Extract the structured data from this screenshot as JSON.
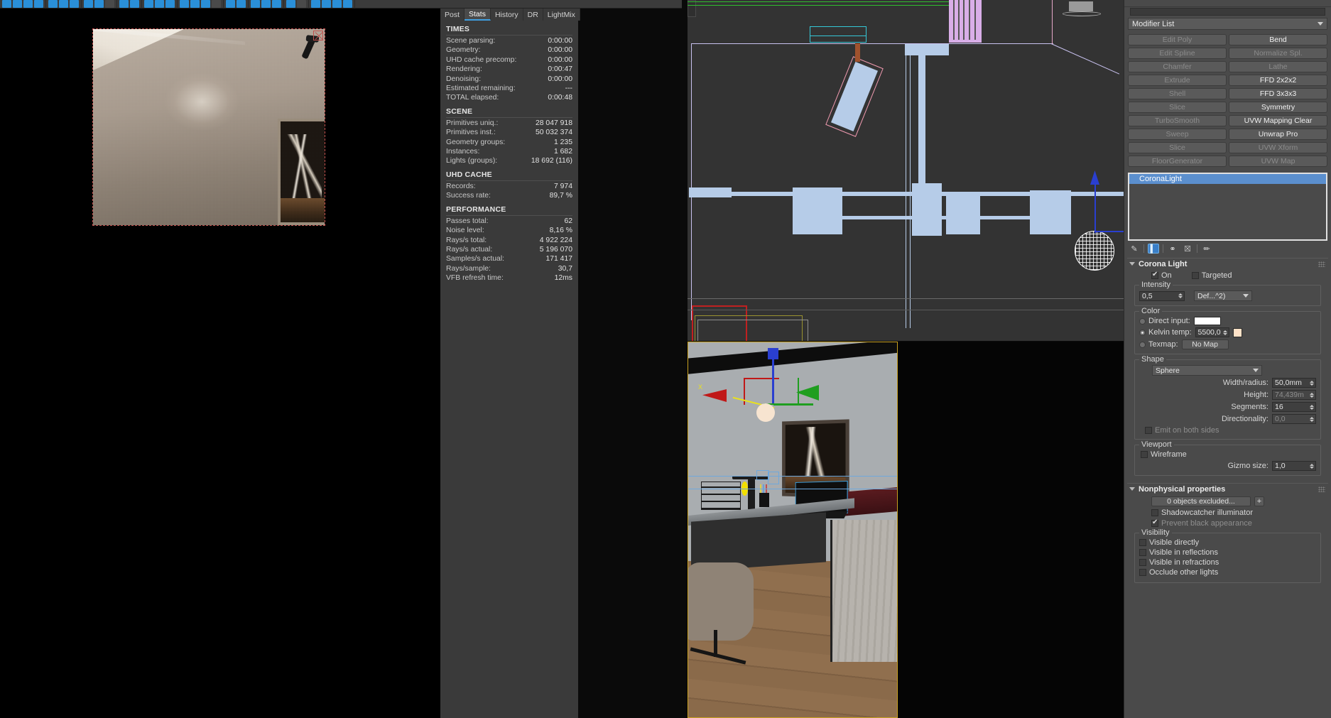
{
  "toolbar": {
    "icon_groups": [
      4,
      3,
      3,
      2,
      3,
      4,
      2,
      3,
      2,
      4
    ]
  },
  "vfb": {
    "tabs": [
      {
        "label": "Post",
        "active": false
      },
      {
        "label": "Stats",
        "active": true
      },
      {
        "label": "History",
        "active": false
      },
      {
        "label": "DR",
        "active": false
      },
      {
        "label": "LightMix",
        "active": false
      }
    ],
    "sections": [
      {
        "title": "TIMES",
        "rows": [
          {
            "key": "Scene parsing:",
            "value": "0:00:00"
          },
          {
            "key": "Geometry:",
            "value": "0:00:00"
          },
          {
            "key": "UHD cache precomp:",
            "value": "0:00:00"
          },
          {
            "key": "Rendering:",
            "value": "0:00:47"
          },
          {
            "key": "Denoising:",
            "value": "0:00:00"
          },
          {
            "key": "Estimated remaining:",
            "value": "---"
          },
          {
            "key": "TOTAL elapsed:",
            "value": "0:00:48"
          }
        ]
      },
      {
        "title": "SCENE",
        "rows": [
          {
            "key": "Primitives uniq.:",
            "value": "28 047 918"
          },
          {
            "key": "Primitives inst.:",
            "value": "50 032 374"
          },
          {
            "key": "Geometry groups:",
            "value": "1 235"
          },
          {
            "key": "Instances:",
            "value": "1 682"
          },
          {
            "key": "Lights (groups):",
            "value": "18 692 (116)"
          }
        ]
      },
      {
        "title": "UHD CACHE",
        "rows": [
          {
            "key": "Records:",
            "value": "7 974"
          },
          {
            "key": "Success rate:",
            "value": "89,7 %"
          }
        ]
      },
      {
        "title": "PERFORMANCE",
        "rows": [
          {
            "key": "Passes total:",
            "value": "62"
          },
          {
            "key": "Noise level:",
            "value": "8,16 %"
          },
          {
            "key": "Rays/s total:",
            "value": "4 922 224"
          },
          {
            "key": "Rays/s actual:",
            "value": "5 196 070"
          },
          {
            "key": "Samples/s actual:",
            "value": "171 417"
          },
          {
            "key": "Rays/sample:",
            "value": "30,7"
          },
          {
            "key": "VFB refresh time:",
            "value": "12ms"
          }
        ]
      }
    ]
  },
  "command_panel": {
    "modifier_list_label": "Modifier List",
    "modifier_buttons": [
      {
        "label": "Edit Poly",
        "enabled": false
      },
      {
        "label": "Bend",
        "enabled": true
      },
      {
        "label": "Edit Spline",
        "enabled": false
      },
      {
        "label": "Normalize Spl.",
        "enabled": false
      },
      {
        "label": "Chamfer",
        "enabled": false
      },
      {
        "label": "Lathe",
        "enabled": false
      },
      {
        "label": "Extrude",
        "enabled": false
      },
      {
        "label": "FFD 2x2x2",
        "enabled": true
      },
      {
        "label": "Shell",
        "enabled": false
      },
      {
        "label": "FFD 3x3x3",
        "enabled": true
      },
      {
        "label": "Slice",
        "enabled": false
      },
      {
        "label": "Symmetry",
        "enabled": true
      },
      {
        "label": "TurboSmooth",
        "enabled": false
      },
      {
        "label": "UVW Mapping Clear",
        "enabled": true
      },
      {
        "label": "Sweep",
        "enabled": false
      },
      {
        "label": "Unwrap Pro",
        "enabled": true
      },
      {
        "label": "Slice",
        "enabled": false
      },
      {
        "label": "UVW Xform",
        "enabled": false
      },
      {
        "label": "FloorGenerator",
        "enabled": false
      },
      {
        "label": "UVW Map",
        "enabled": false
      }
    ],
    "modifier_stack": [
      {
        "label": "CoronaLight",
        "selected": true
      }
    ],
    "stack_tools": [
      {
        "name": "pin-stack-icon",
        "glyph": "✒",
        "active": false
      },
      {
        "name": "show-end-result-icon",
        "glyph": "▐",
        "active": true
      },
      {
        "name": "make-unique-icon",
        "glyph": "⚭",
        "active": false
      },
      {
        "name": "remove-modifier-icon",
        "glyph": "Ὕ1",
        "active": false
      },
      {
        "name": "configure-sets-icon",
        "glyph": "✎",
        "active": false
      }
    ],
    "corona_light": {
      "title": "Corona Light",
      "on_label": "On",
      "on_checked": true,
      "targeted_label": "Targeted",
      "targeted_checked": false,
      "intensity_group": "Intensity",
      "intensity_value": "0,5",
      "intensity_units": "Def...^2)",
      "color_group": "Color",
      "direct_input_label": "Direct input:",
      "direct_input_selected": false,
      "direct_input_color": "#ffffff",
      "kelvin_label": "Kelvin temp:",
      "kelvin_selected": true,
      "kelvin_value": "5500,0",
      "kelvin_color": "#ffe2c8",
      "texmap_label": "Texmap:",
      "texmap_selected": false,
      "texmap_value": "No Map",
      "shape_group": "Shape",
      "shape_value": "Sphere",
      "width_radius_label": "Width/radius:",
      "width_radius_value": "50,0mm",
      "height_label": "Height:",
      "height_value": "74,439m",
      "segments_label": "Segments:",
      "segments_value": "16",
      "directionality_label": "Directionality:",
      "directionality_value": "0,0",
      "emit_both_label": "Emit on both sides",
      "emit_both_checked": false,
      "viewport_group": "Viewport",
      "wireframe_label": "Wireframe",
      "wireframe_checked": false,
      "gizmo_label": "Gizmo size:",
      "gizmo_value": "1,0"
    },
    "nonphysical": {
      "title": "Nonphysical properties",
      "exclude_button": "0 objects excluded...",
      "add_button": "+",
      "shadowcatcher_label": "Shadowcatcher illuminator",
      "shadowcatcher_checked": false,
      "prevent_black_label": "Prevent black appearance",
      "prevent_black_checked": true,
      "visibility_group": "Visibility",
      "visibility_items": [
        {
          "label": "Visible directly",
          "checked": false
        },
        {
          "label": "Visible in reflections",
          "checked": false
        },
        {
          "label": "Visible in refractions",
          "checked": false
        },
        {
          "label": "Occlude other lights",
          "checked": false
        }
      ]
    }
  }
}
